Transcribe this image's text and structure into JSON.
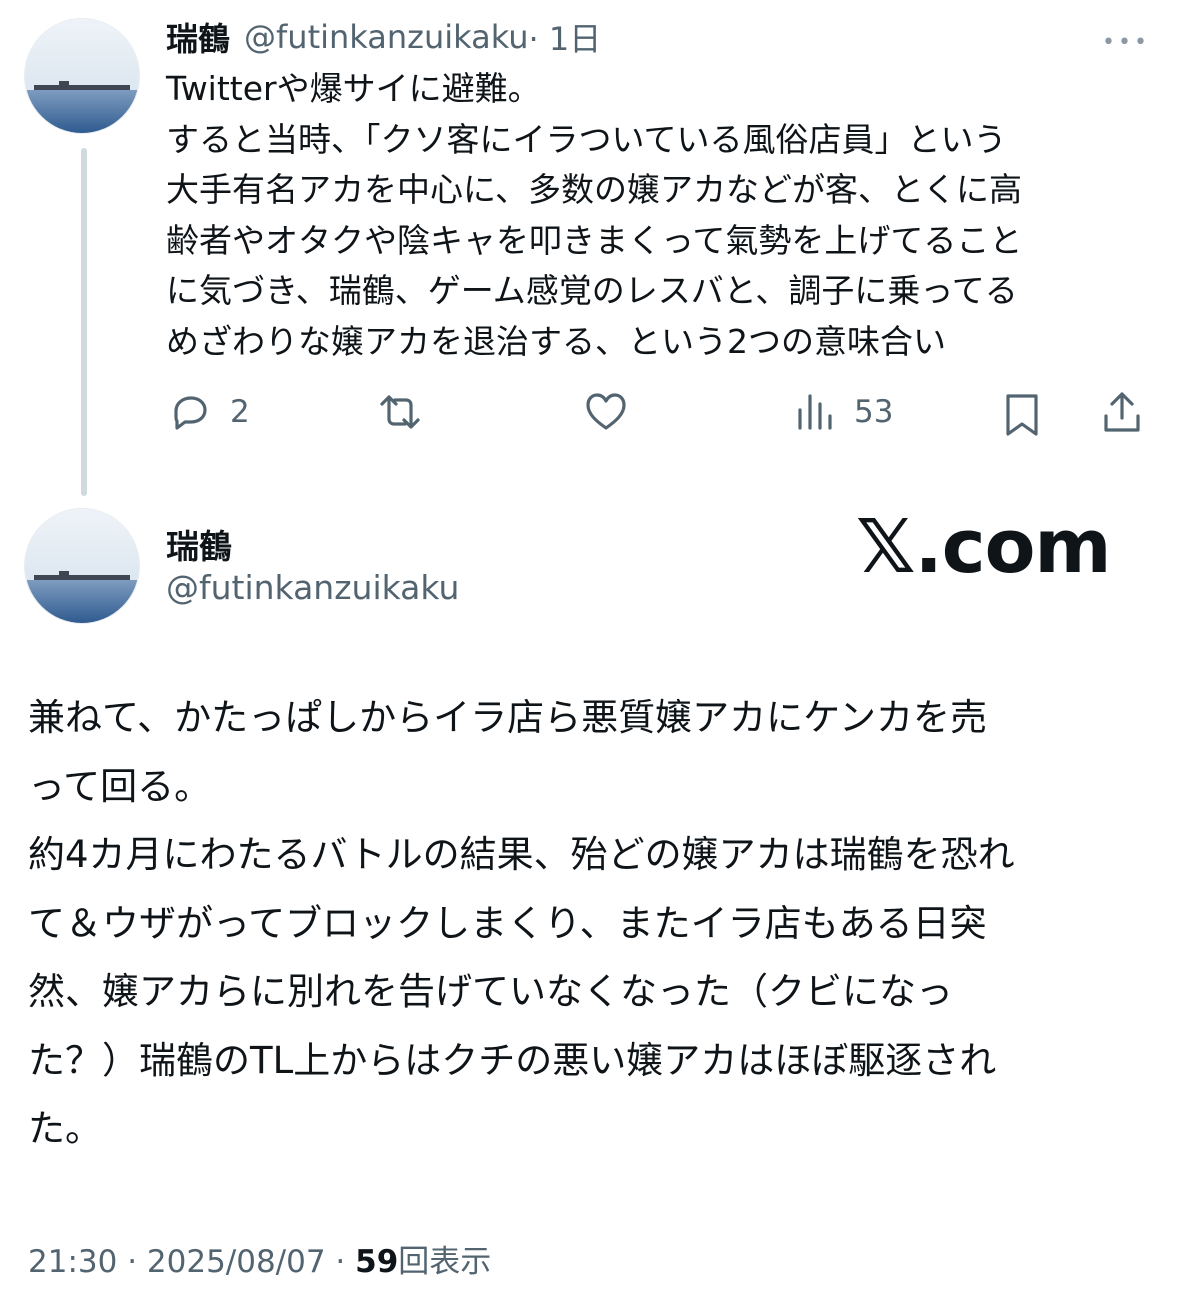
{
  "thread_tweet": {
    "author_name": "瑞鶴",
    "handle": "@futinkanzuikaku",
    "time": "· 1日",
    "more_label": "•••",
    "lines": [
      "Twitterや爆サイに避難。",
      "すると当時、「クソ客にイラついている風俗店員」という",
      "大手有名アカを中心に、多数の嬢アカなどが客、とくに高",
      "齢者やオタクや陰キャを叩きまくって氣勢を上げてること",
      "に気づき、瑞鶴、ゲーム感覚のレスバと、調子に乗ってる",
      "めざわりな嬢アカを退治する、という2つの意味合い"
    ],
    "actions": {
      "reply_count": "2",
      "views_count": "53"
    }
  },
  "main_tweet": {
    "author_name": "瑞鶴",
    "handle": "@futinkanzuikaku",
    "watermark": "𝕏.com",
    "lines": [
      "兼ねて、かたっぱしからイラ店ら悪質嬢アカにケンカを売",
      "って回る。",
      "約4カ月にわたるバトルの結果、殆どの嬢アカは瑞鶴を恐れ",
      "て＆ウザがってブロックしまくり、またイラ店もある日突",
      "然、嬢アカらに別れを告げていなくなった（クビになっ",
      "た？）瑞鶴のTL上からはクチの悪い嬢アカはほぼ駆逐され",
      "た。"
    ],
    "timestamp": "21:30 · 2025/08/07 · ",
    "view_count": "59",
    "view_label": "回表示"
  },
  "icons": [
    "reply-icon",
    "retweet-icon",
    "like-icon",
    "views-icon",
    "bookmark-icon",
    "share-icon",
    "more-icon"
  ],
  "colors": {
    "text": "#0f1419",
    "secondary": "#536471",
    "thread_line": "#cfd9de"
  }
}
